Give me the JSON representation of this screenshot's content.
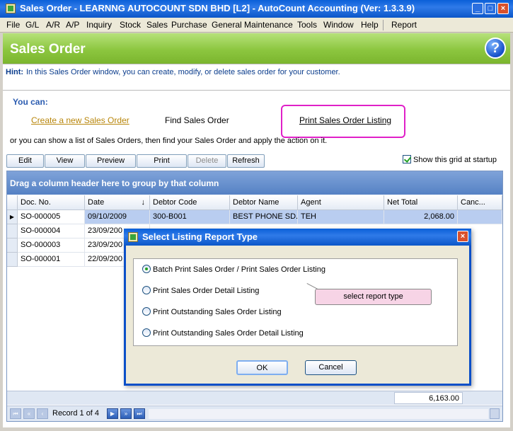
{
  "window": {
    "title": "Sales Order - LEARNNG AUTOCOUNT SDN BHD [L2] - AutoCount Accounting (Ver: 1.3.3.9)",
    "minimize": "_",
    "maximize": "□",
    "close": "×"
  },
  "menu": {
    "items": [
      "File",
      "G/L",
      "A/R",
      "A/P",
      "Inquiry",
      "Stock",
      "Sales",
      "Purchase",
      "General Maintenance",
      "Tools",
      "Window",
      "Help",
      "Report"
    ]
  },
  "header": {
    "title": "Sales Order",
    "help_glyph": "?"
  },
  "hint": {
    "label": "Hint:",
    "text": "In this Sales Order window, you can create, modify, or delete sales order for your customer."
  },
  "actions": {
    "you_can": "You can:",
    "create": "Create a new Sales Order",
    "find": "Find Sales Order",
    "print": "Print Sales Order Listing",
    "info": "or you can show a list of Sales Orders, then find your Sales Order and apply the action on it."
  },
  "toolbar": {
    "edit": "Edit",
    "view": "View",
    "preview": "Preview",
    "print": "Print",
    "delete": "Delete",
    "refresh": "Refresh",
    "show_grid": "Show this grid at startup"
  },
  "grid": {
    "group_hint": "Drag a column header here to group by that column",
    "columns": [
      "Doc. No.",
      "Date",
      "Debtor Code",
      "Debtor Name",
      "Agent",
      "Net Total",
      "Canc..."
    ],
    "sort_glyph": "↓",
    "rows": [
      [
        "SO-000005",
        "09/10/2009",
        "300-B001",
        "BEST PHONE SD...",
        "TEH",
        "2,068.00",
        ""
      ],
      [
        "SO-000004",
        "23/09/200",
        "",
        "",
        "",
        "",
        ""
      ],
      [
        "SO-000003",
        "23/09/200",
        "",
        "",
        "",
        "",
        ""
      ],
      [
        "SO-000001",
        "22/09/200",
        "",
        "",
        "",
        "",
        ""
      ]
    ],
    "current_row_glyph": "▶",
    "total": "6,163.00",
    "record_text": "Record 1 of 4"
  },
  "navigator": {
    "first": "⏮",
    "prev_page": "«",
    "prev": "‹",
    "next": "▶",
    "next_page": "»",
    "last": "⏭"
  },
  "dialog": {
    "title": "Select Listing Report Type",
    "close": "×",
    "options": [
      "Batch Print Sales Order / Print Sales Order Listing",
      "Print Sales Order Detail Listing",
      "Print Outstanding Sales Order Listing",
      "Print Outstanding Sales Order Detail Listing"
    ],
    "callout": "select report type",
    "ok": "OK",
    "cancel": "Cancel"
  }
}
